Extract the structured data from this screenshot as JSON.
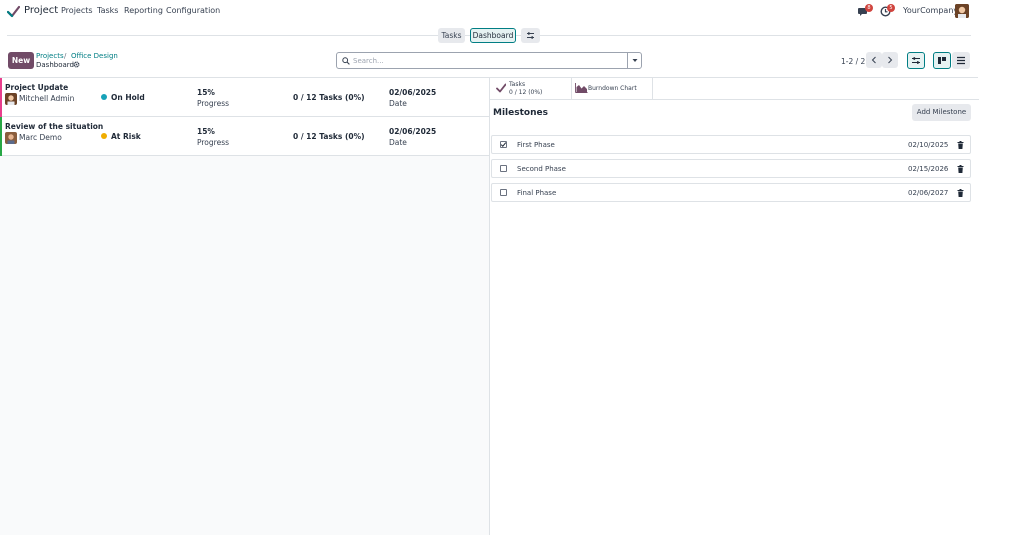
{
  "navbar": {
    "app_name": "Project",
    "menus": [
      "Projects",
      "Tasks",
      "Reporting",
      "Configuration"
    ],
    "messages_badge": "8",
    "activities_badge": "5",
    "company": "YourCompany"
  },
  "views": {
    "tasks_label": "Tasks",
    "dashboard_label": "Dashboard"
  },
  "control": {
    "new_label": "New",
    "breadcrumb": [
      "Projects",
      "Office Design"
    ],
    "breadcrumb_sep": "/",
    "current": "Dashboard",
    "search_placeholder": "Search...",
    "pager": "1-2 / 2"
  },
  "updates": [
    {
      "title": "Project Update",
      "user": "Mitchell Admin",
      "status": "On Hold",
      "status_color": "#17a2b8",
      "bar_color": "#e83e8c",
      "progress": "15%",
      "progress_label": "Progress",
      "tasks": "0 / 12 Tasks (0%)",
      "date": "02/06/2025",
      "date_label": "Date"
    },
    {
      "title": "Review of the situation",
      "user": "Marc Demo",
      "status": "At Risk",
      "status_color": "#f0ad00",
      "bar_color": "#28a745",
      "progress": "15%",
      "progress_label": "Progress",
      "tasks": "0 / 12 Tasks (0%)",
      "date": "02/06/2025",
      "date_label": "Date"
    }
  ],
  "stats": {
    "tasks_title": "Tasks",
    "tasks_value": "0 / 12 (0%)",
    "burndown_label": "Burndown Chart"
  },
  "milestones": {
    "heading": "Milestones",
    "add_label": "Add Milestone",
    "items": [
      {
        "name": "First Phase",
        "date": "02/10/2025",
        "checked": true
      },
      {
        "name": "Second Phase",
        "date": "02/15/2026",
        "checked": false
      },
      {
        "name": "Final Phase",
        "date": "02/06/2027",
        "checked": false
      }
    ]
  },
  "colors": {
    "brand": "#714b67",
    "accent": "#017e84"
  }
}
